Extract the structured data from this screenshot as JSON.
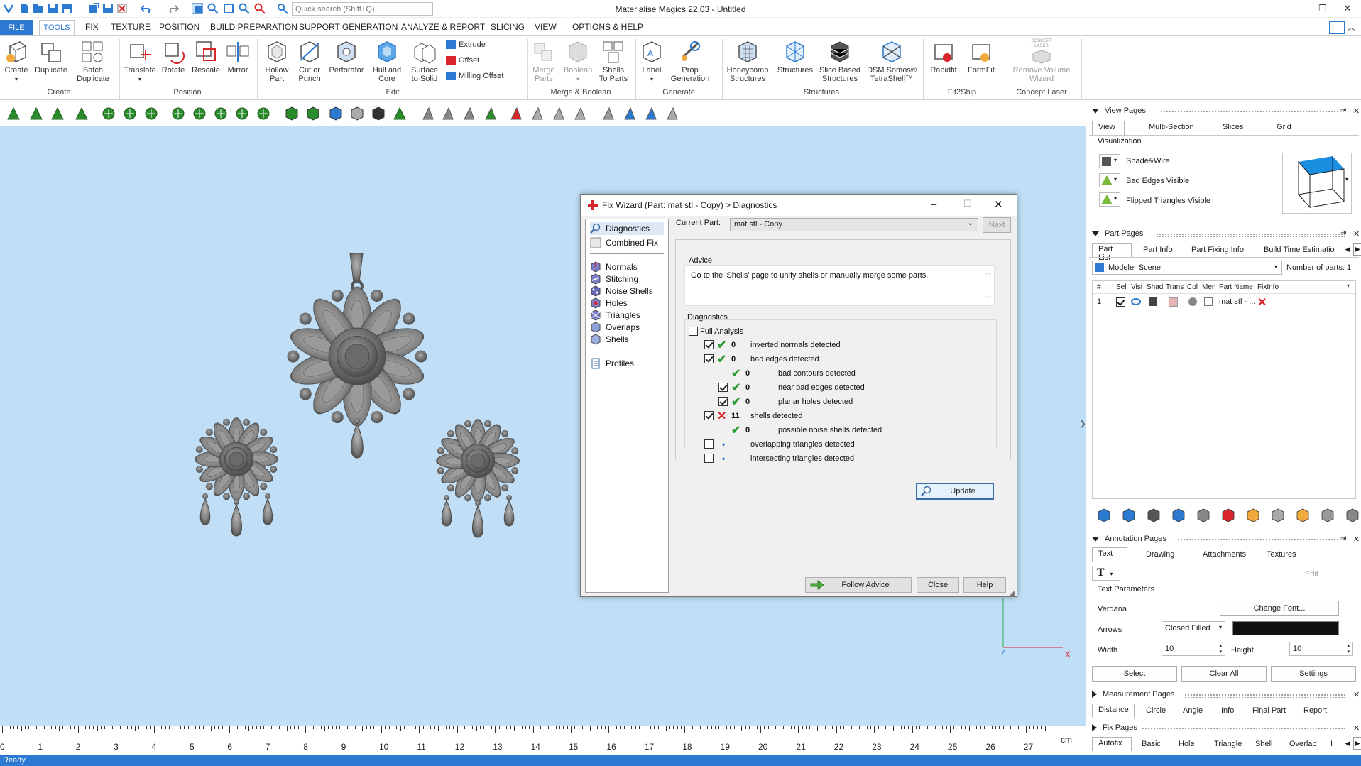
{
  "app": {
    "title": "Materialise Magics 22.03 - Untitled",
    "search_placeholder": "Quick search (Shift+Q)",
    "status": "Ready"
  },
  "ribbon_tabs": [
    "FILE",
    "TOOLS",
    "FIX",
    "TEXTURE",
    "POSITION",
    "BUILD PREPARATION",
    "SUPPORT GENERATION",
    "ANALYZE & REPORT",
    "SLICING",
    "VIEW",
    "OPTIONS & HELP"
  ],
  "ribbon": {
    "create": {
      "create": "Create",
      "duplicate": "Duplicate",
      "batch1": "Batch",
      "batch2": "Duplicate",
      "group": "Create"
    },
    "position": {
      "translate": "Translate",
      "rotate": "Rotate",
      "rescale": "Rescale",
      "mirror": "Mirror",
      "group": "Position"
    },
    "edit": {
      "hollow1": "Hollow",
      "hollow2": "Part",
      "cut1": "Cut or",
      "cut2": "Punch",
      "perforator": "Perforator",
      "hull1": "Hull and",
      "hull2": "Core",
      "surface1": "Surface",
      "surface2": "to Solid",
      "extrude": "Extrude",
      "offset": "Offset",
      "milling": "Milling Offset",
      "group": "Edit"
    },
    "merge": {
      "merge1": "Merge",
      "merge2": "Parts",
      "boolean": "Boolean",
      "shells1": "Shells",
      "shells2": "To Parts",
      "group": "Merge & Boolean"
    },
    "generate": {
      "label": "Label",
      "prop1": "Prop",
      "prop2": "Generation",
      "group": "Generate"
    },
    "structures": {
      "honey1": "Honeycomb",
      "honey2": "Structures",
      "structures": "Structures",
      "slice1": "Slice Based",
      "slice2": "Structures",
      "dsm1": "DSM Somos®",
      "dsm2": "TetraShell™",
      "group": "Structures"
    },
    "fit2ship": {
      "rapidfit": "Rapidfit",
      "formfit": "FormFit",
      "group": "Fit2Ship"
    },
    "concept": {
      "badge1": "CONCEPT",
      "badge2": "LASER",
      "remove1": "Remove Volume",
      "remove2": "Wizard",
      "group": "Concept Laser"
    }
  },
  "ruler": {
    "unit": "cm",
    "labels": [
      "0",
      "1",
      "2",
      "3",
      "4",
      "5",
      "6",
      "7",
      "8",
      "9",
      "10",
      "11",
      "12",
      "13",
      "14",
      "15",
      "16",
      "17",
      "18",
      "19",
      "20",
      "21",
      "22",
      "23",
      "24",
      "25",
      "26",
      "27"
    ]
  },
  "axis": {
    "z": "Z",
    "x": "X"
  },
  "dialog": {
    "title": "Fix Wizard (Part: mat stl - Copy) > Diagnostics",
    "nav": [
      "Diagnostics",
      "Combined Fix",
      "Normals",
      "Stitching",
      "Noise Shells",
      "Holes",
      "Triangles",
      "Overlaps",
      "Shells",
      "Profiles"
    ],
    "current_part_label": "Current Part:",
    "current_part_value": "mat stl - Copy",
    "next": "Next",
    "advice_label": "Advice",
    "advice_text": "Go to the 'Shells' page to unify shells or manually merge some parts.",
    "diagnostics_label": "Diagnostics",
    "full_analysis": "Full Analysis",
    "rows": [
      {
        "count": "0",
        "text": "inverted normals detected",
        "checked": true,
        "status": "ok",
        "indent": 0
      },
      {
        "count": "0",
        "text": "bad edges detected",
        "checked": true,
        "status": "ok",
        "indent": 0
      },
      {
        "count": "0",
        "text": "bad contours detected",
        "checked": null,
        "status": "ok",
        "indent": 1
      },
      {
        "count": "0",
        "text": "near bad edges detected",
        "checked": true,
        "status": "ok",
        "indent": 1
      },
      {
        "count": "0",
        "text": "planar holes detected",
        "checked": true,
        "status": "ok",
        "indent": 1
      },
      {
        "count": "11",
        "text": "shells detected",
        "checked": true,
        "status": "error",
        "indent": 0
      },
      {
        "count": "0",
        "text": "possible noise shells detected",
        "checked": null,
        "status": "ok",
        "indent": 1
      },
      {
        "count": "",
        "text": "overlapping triangles detected",
        "checked": false,
        "status": "none",
        "indent": 0
      },
      {
        "count": "",
        "text": "intersecting triangles detected",
        "checked": false,
        "status": "none",
        "indent": 0
      }
    ],
    "update": "Update",
    "follow_advice": "Follow Advice",
    "close": "Close",
    "help": "Help"
  },
  "right_panel": {
    "view_pages": {
      "title": "View Pages",
      "tabs": [
        "View",
        "Multi-Section",
        "Slices",
        "Grid"
      ],
      "visualization": "Visualization",
      "items": [
        "Shade&Wire",
        "Bad Edges Visible",
        "Flipped Triangles Visible"
      ]
    },
    "part_pages": {
      "title": "Part Pages",
      "tabs": [
        "Part List",
        "Part Info",
        "Part Fixing Info",
        "Build Time Estimatio"
      ],
      "scene": "Modeler Scene",
      "num_parts_label": "Number of parts:",
      "num_parts": "1",
      "columns": [
        "#",
        "Sel",
        "Visi",
        "Shad",
        "Trans",
        "Col",
        "Men",
        "Part Name",
        "FixInfo"
      ],
      "row": {
        "index": "1",
        "name": "mat stl - ..."
      }
    },
    "annotation_pages": {
      "title": "Annotation Pages",
      "tabs": [
        "Text",
        "Drawing",
        "Attachments",
        "Textures"
      ],
      "edit": "Edit",
      "text_params": "Text Parameters",
      "font": "Verdana",
      "change_font": "Change Font...",
      "arrows_label": "Arrows",
      "arrows_value": "Closed Filled",
      "width_label": "Width",
      "width_value": "10",
      "height_label": "Height",
      "height_value": "10",
      "select": "Select",
      "clear_all": "Clear All",
      "settings": "Settings"
    },
    "measurement_pages": {
      "title": "Measurement Pages",
      "tabs": [
        "Distance",
        "Circle",
        "Angle",
        "Info",
        "Final Part",
        "Report"
      ]
    },
    "fix_pages": {
      "title": "Fix Pages",
      "tabs": [
        "Autofix",
        "Basic",
        "Hole",
        "Triangle",
        "Shell",
        "Overlap",
        "I"
      ]
    }
  }
}
